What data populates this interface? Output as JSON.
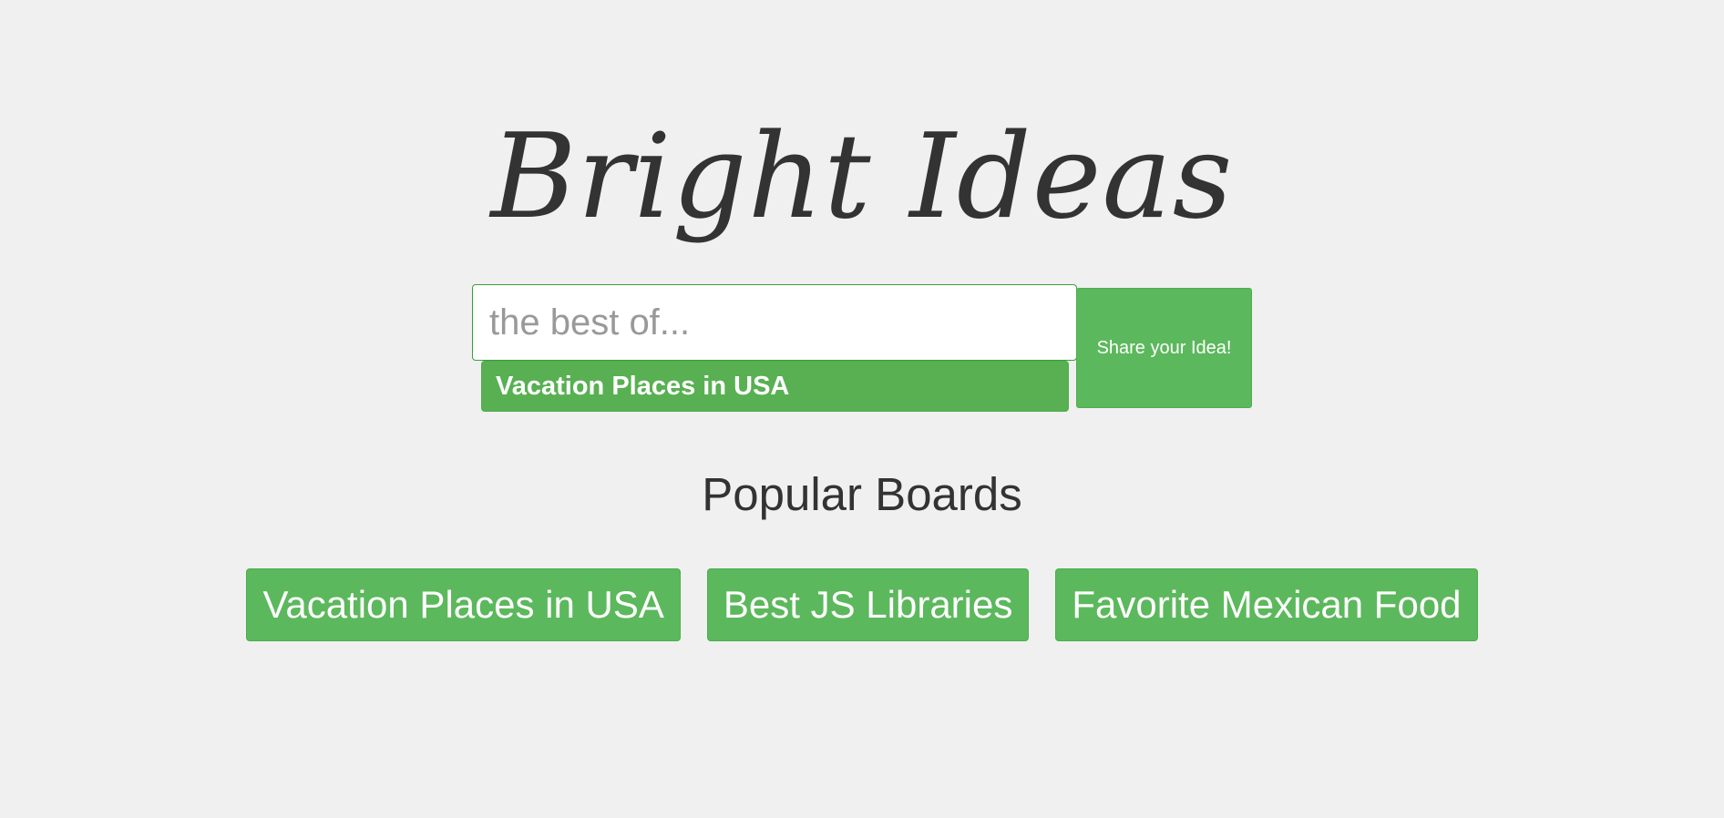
{
  "app": {
    "title": "Bright Ideas"
  },
  "search": {
    "placeholder": "the best of...",
    "value": "",
    "suggestion": "Vacation Places in USA",
    "share_label": "Share your Idea!"
  },
  "popular": {
    "heading": "Popular Boards",
    "boards": [
      {
        "label": "Vacation Places in USA"
      },
      {
        "label": "Best JS Libraries"
      },
      {
        "label": "Favorite Mexican Food"
      }
    ]
  },
  "colors": {
    "background": "#f0f0f0",
    "accent": "#5cb85c",
    "text": "#333333"
  }
}
